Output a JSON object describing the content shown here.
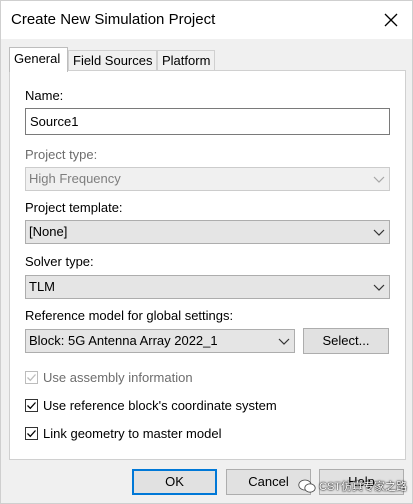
{
  "window": {
    "title": "Create New Simulation Project"
  },
  "tabs": [
    {
      "label": "General",
      "active": true
    },
    {
      "label": "Field Sources",
      "active": false
    },
    {
      "label": "Platform",
      "active": false
    }
  ],
  "general": {
    "name_label": "Name:",
    "name_value": "Source1",
    "project_type_label": "Project type:",
    "project_type_value": "High Frequency",
    "project_template_label": "Project template:",
    "project_template_value": "[None]",
    "solver_type_label": "Solver type:",
    "solver_type_value": "TLM",
    "reference_model_label": "Reference model for global settings:",
    "reference_model_value": "Block: 5G Antenna Array 2022_1",
    "select_button": "Select...",
    "checkboxes": [
      {
        "label": "Use assembly information",
        "checked": true,
        "enabled": false
      },
      {
        "label": "Use reference block's coordinate system",
        "checked": true,
        "enabled": true
      },
      {
        "label": "Link geometry to master model",
        "checked": true,
        "enabled": true
      }
    ]
  },
  "footer": {
    "ok": "OK",
    "cancel": "Cancel",
    "help": "Help"
  },
  "watermark": {
    "text": "CST仿真专家之路"
  },
  "icons": {
    "close": "close-icon",
    "dropdown": "chevron-down-icon",
    "check": "checkmark-icon"
  }
}
